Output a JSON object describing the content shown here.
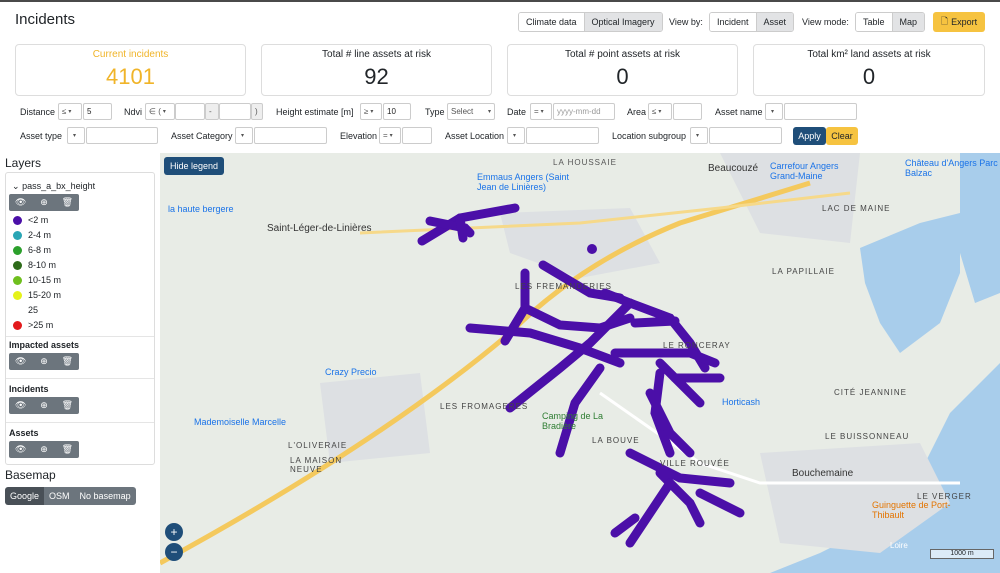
{
  "page": {
    "title": "Incidents"
  },
  "header": {
    "imagery_tabs": [
      "Climate data",
      "Optical Imagery"
    ],
    "view_by_label": "View by:",
    "view_by_options": [
      "Incident",
      "Asset"
    ],
    "view_mode_label": "View mode:",
    "view_mode_options": [
      "Table",
      "Map"
    ],
    "export_label": "Export"
  },
  "cards": [
    {
      "title": "Current incidents",
      "value": "4101"
    },
    {
      "title": "Total # line assets at risk",
      "value": "92"
    },
    {
      "title": "Total # point assets at risk",
      "value": "0"
    },
    {
      "title": "Total km² land assets at risk",
      "value": "0"
    }
  ],
  "filters": {
    "distance": {
      "label": "Distance",
      "op": "≤",
      "value": "5"
    },
    "ndvi": {
      "label": "Ndvi",
      "op": "∈ (",
      "mid": "-",
      "close": ")"
    },
    "height": {
      "label": "Height estimate [m]",
      "op": "≥",
      "value": "10"
    },
    "type": {
      "label": "Type",
      "placeholder": "Select"
    },
    "date": {
      "label": "Date",
      "op": "=",
      "placeholder": "yyyy-mm-dd"
    },
    "area": {
      "label": "Area",
      "op": "≤"
    },
    "asset_name": {
      "label": "Asset name"
    },
    "asset_type": {
      "label": "Asset type"
    },
    "asset_category": {
      "label": "Asset Category"
    },
    "elevation": {
      "label": "Elevation",
      "op": "="
    },
    "asset_location": {
      "label": "Asset Location"
    },
    "location_subgroup": {
      "label": "Location subgroup"
    },
    "apply_label": "Apply",
    "clear_label": "Clear"
  },
  "layers": {
    "title": "Layers",
    "group1": "pass_a_bx_height",
    "legend": [
      {
        "label": "<2 m",
        "color": "#4b0fa8"
      },
      {
        "label": "2-4 m",
        "color": "#2aa6b5"
      },
      {
        "label": "6-8 m",
        "color": "#2ca02c"
      },
      {
        "label": "8-10 m",
        "color": "#2e6b1a"
      },
      {
        "label": "10-15 m",
        "color": "#6fbf1e"
      },
      {
        "label": "15-20 m",
        "color": "#e5f21a"
      },
      {
        "label": "25",
        "color": ""
      },
      {
        "label": ">25 m",
        "color": "#e31a1c"
      }
    ],
    "group2": "Impacted assets",
    "group3": "Incidents",
    "group4": "Assets"
  },
  "basemap": {
    "title": "Basemap",
    "options": [
      "Google",
      "OSM",
      "No basemap"
    ]
  },
  "map": {
    "hide_legend_label": "Hide legend",
    "zoom_in": "+",
    "zoom_out": "−",
    "scale_label": "1000 m",
    "place_labels": [
      {
        "text": "LA HOUSSAIE"
      },
      {
        "text": "Beaucouzé"
      },
      {
        "text": "Carrefour Angers Grand-Maine"
      },
      {
        "text": "Château d'Angers Parc Balzac"
      },
      {
        "text": "Saint-Léger-de-Linières"
      },
      {
        "text": "la haute bergere"
      },
      {
        "text": "Emmaus Angers (Saint Jean de Linières)"
      },
      {
        "text": "LAC DE MAINE"
      },
      {
        "text": "LA PAPILLAIE"
      },
      {
        "text": "LES FREMANDERIES"
      },
      {
        "text": "LE RONCERAY"
      },
      {
        "text": "Crazy Precio"
      },
      {
        "text": "Horticash"
      },
      {
        "text": "CITÉ JEANNINE"
      },
      {
        "text": "Mademoiselle Marcelle"
      },
      {
        "text": "LES FROMAGERES"
      },
      {
        "text": "Camping de La Bradière"
      },
      {
        "text": "L'OLIVERAIE"
      },
      {
        "text": "LA MAISON NEUVE"
      },
      {
        "text": "LA BOUVE"
      },
      {
        "text": "VILLE ROUVÉE"
      },
      {
        "text": "LE BUISSONNEAU"
      },
      {
        "text": "Bouchemaine"
      },
      {
        "text": "LE VERGER"
      },
      {
        "text": "Guinguette de Port-Thibault"
      },
      {
        "text": "Loire"
      }
    ]
  }
}
